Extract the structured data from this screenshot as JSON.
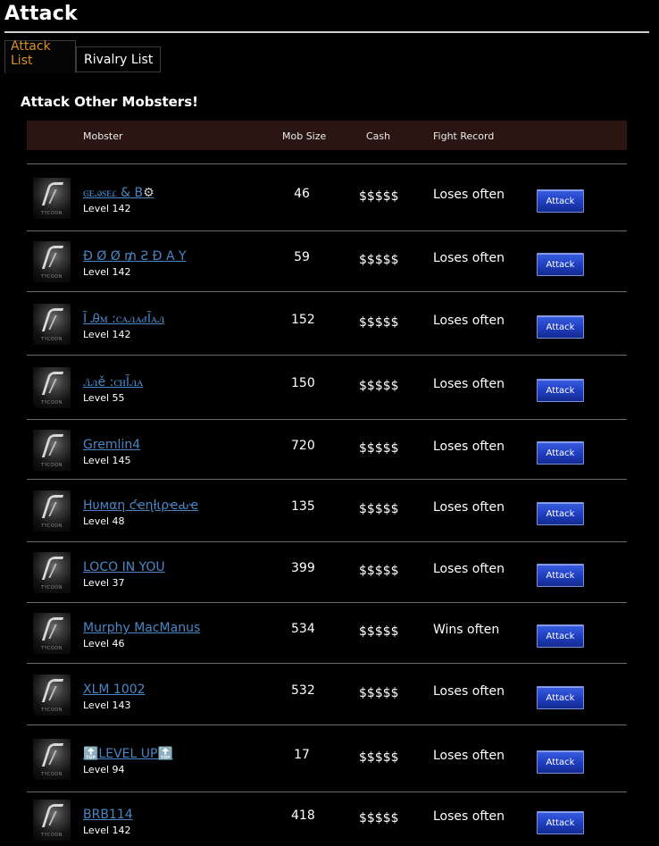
{
  "page": {
    "title": "Attack"
  },
  "tabs": [
    {
      "label": "Attack List",
      "active": true
    },
    {
      "label": "Rivalry List",
      "active": false
    }
  ],
  "section": {
    "heading": "Attack Other Mobsters!"
  },
  "table": {
    "headers": {
      "mobster": "Mobster",
      "mob_size": "Mob Size",
      "cash": "Cash",
      "fight_record": "Fight Record"
    },
    "avatar_tag": "TYCOON",
    "rows": [
      {
        "name": "ꮆꭼꭿꮪꭼꮭ & B",
        "icon": "gear-icon",
        "level": "Level 142",
        "mob_size": "46",
        "cash": "$$$$$",
        "record": "Loses often",
        "button": "Attack"
      },
      {
        "name": "Ð Ø Ø ₥ Ƨ Ð A Y",
        "level": "Level 142",
        "mob_size": "59",
        "cash": "$$$$$",
        "record": "Loses often",
        "button": "Attack"
      },
      {
        "name": "Ĩ Ꭿꮇ :ꮯꭺꮑꭺꮷĨꭺꮑ",
        "level": "Level 142",
        "mob_size": "152",
        "cash": "$$$$$",
        "record": "Loses often",
        "button": "Attack"
      },
      {
        "name": "ꮑ̃ꮑě :ꮯꮋĨꮑꭺ",
        "level": "Level 55",
        "mob_size": "150",
        "cash": "$$$$$",
        "record": "Loses often",
        "button": "Attack"
      },
      {
        "name": "Gremlin4",
        "level": "Level 145",
        "mob_size": "720",
        "cash": "$$$$$",
        "record": "Loses often",
        "button": "Attack"
      },
      {
        "name": "Hυмαη ƈҽɳƚιρҽԃҽ",
        "level": "Level 48",
        "mob_size": "135",
        "cash": "$$$$$",
        "record": "Loses often",
        "button": "Attack"
      },
      {
        "name": "LOCO IN YOU",
        "level": "Level 37",
        "mob_size": "399",
        "cash": "$$$$$",
        "record": "Loses often",
        "button": "Attack"
      },
      {
        "name": "Murphy MacManus",
        "level": "Level 46",
        "mob_size": "534",
        "cash": "$$$$$",
        "record": "Wins often",
        "button": "Attack"
      },
      {
        "name": "XLM 1002",
        "level": "Level 143",
        "mob_size": "532",
        "cash": "$$$$$",
        "record": "Loses often",
        "button": "Attack"
      },
      {
        "name": "🔝LEVEL UP🔝",
        "level": "Level 94",
        "mob_size": "17",
        "cash": "$$$$$",
        "record": "Loses often",
        "button": "Attack"
      },
      {
        "name": "BRB114",
        "level": "Level 142",
        "mob_size": "418",
        "cash": "$$$$$",
        "record": "Loses often",
        "button": "Attack"
      }
    ]
  }
}
